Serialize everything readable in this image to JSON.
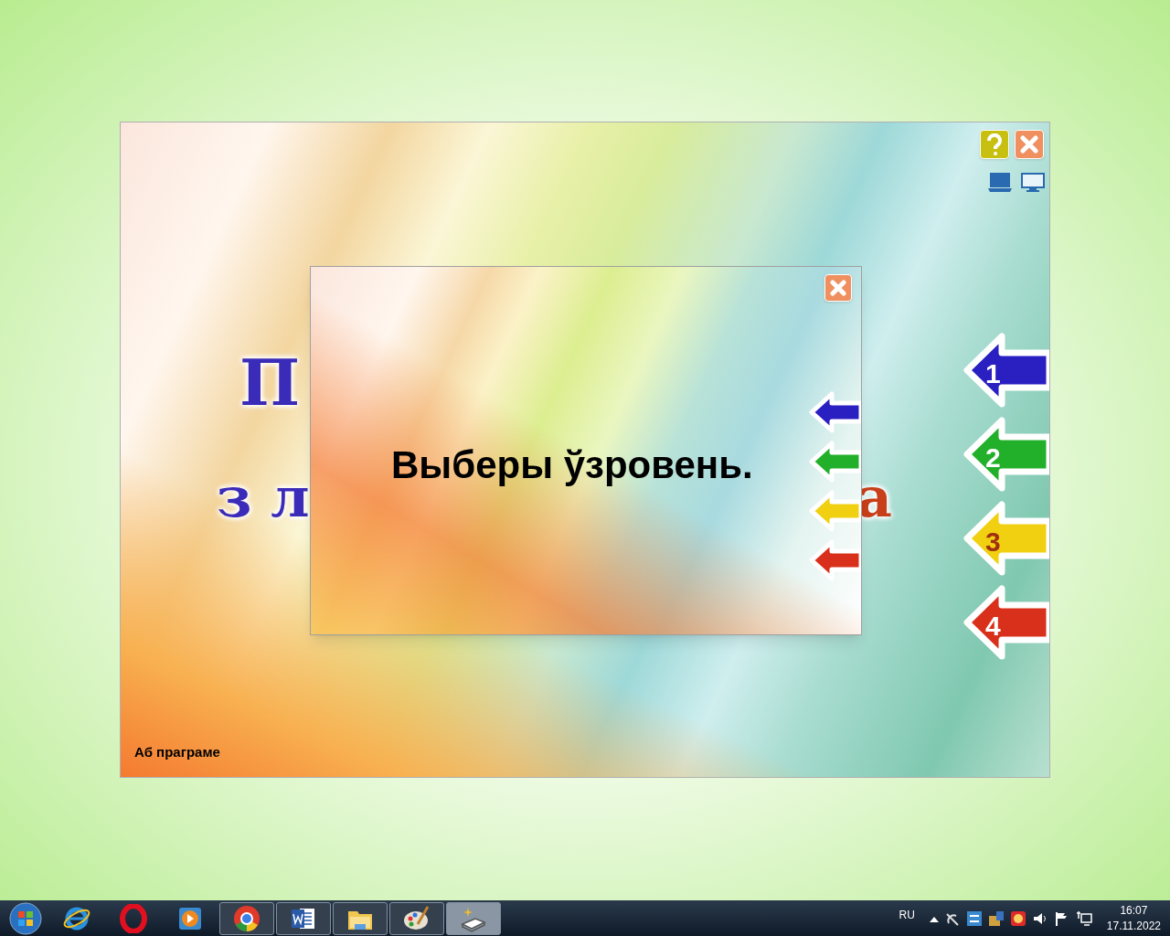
{
  "main_window": {
    "title_fragments": [
      {
        "kind": "line1",
        "text": "П"
      },
      {
        "kind": "line2_left",
        "text": "з л"
      },
      {
        "kind": "line2_right",
        "text": "а"
      }
    ],
    "top_buttons": [
      {
        "kind": "help"
      },
      {
        "kind": "close"
      }
    ],
    "display_buttons": [
      {
        "kind": "window",
        "selected": true
      },
      {
        "kind": "fullscreen",
        "selected": false
      }
    ],
    "level_buttons": [
      {
        "label": "1",
        "color": "#2a1fc0"
      },
      {
        "label": "2",
        "color": "#22b02a"
      },
      {
        "label": "3",
        "color": "#f0d010"
      },
      {
        "label": "4",
        "color": "#d8301a"
      }
    ],
    "about_link": "Аб праграме"
  },
  "dialog": {
    "message": "Выберы ўзровень.",
    "small_arrows": [
      {
        "color": "#2a1fc0"
      },
      {
        "color": "#22b02a"
      },
      {
        "color": "#f0d010"
      },
      {
        "color": "#d8301a"
      }
    ]
  },
  "taskbar": {
    "items": [
      {
        "kind": "ie",
        "running": false,
        "selected": false
      },
      {
        "kind": "opera",
        "running": false,
        "selected": false
      },
      {
        "kind": "media",
        "running": false,
        "selected": false
      },
      {
        "kind": "chrome",
        "running": true,
        "selected": false
      },
      {
        "kind": "word",
        "running": true,
        "selected": false
      },
      {
        "kind": "explorer",
        "running": true,
        "selected": false
      },
      {
        "kind": "paint",
        "running": true,
        "selected": false
      },
      {
        "kind": "app",
        "running": true,
        "selected": true
      }
    ],
    "language": "RU",
    "time": "16:07",
    "date": "17.11.2022"
  }
}
